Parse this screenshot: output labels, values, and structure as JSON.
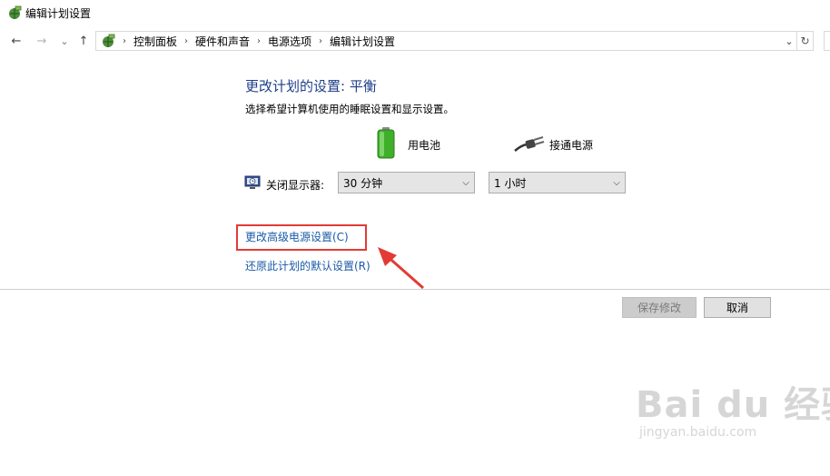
{
  "window": {
    "title": "编辑计划设置"
  },
  "nav": {
    "back": "←",
    "forward": "→",
    "recent": "⌄",
    "up": "↑"
  },
  "address": {
    "crumbs": [
      "控制面板",
      "硬件和声音",
      "电源选项",
      "编辑计划设置"
    ],
    "separator": "›",
    "dropdown": "⌄",
    "refresh": "↻"
  },
  "main": {
    "heading": "更改计划的设置: 平衡",
    "subtitle": "选择希望计算机使用的睡眠设置和显示设置。",
    "battery_label": "用电池",
    "plugged_label": "接通电源",
    "display_off": {
      "label": "关闭显示器:",
      "battery_value": "30 分钟",
      "plugged_value": "1 小时"
    },
    "advanced_link": "更改高级电源设置(C)",
    "restore_link": "还原此计划的默认设置(R)"
  },
  "buttons": {
    "save": "保存修改",
    "cancel": "取消"
  },
  "watermark": {
    "brand": "Bai du 经验",
    "url": "jingyan.baidu.com"
  },
  "colors": {
    "heading": "#1e3e8a",
    "link": "#1a5aa8",
    "highlight": "#e23b35",
    "battery_green": "#3fae2a"
  }
}
